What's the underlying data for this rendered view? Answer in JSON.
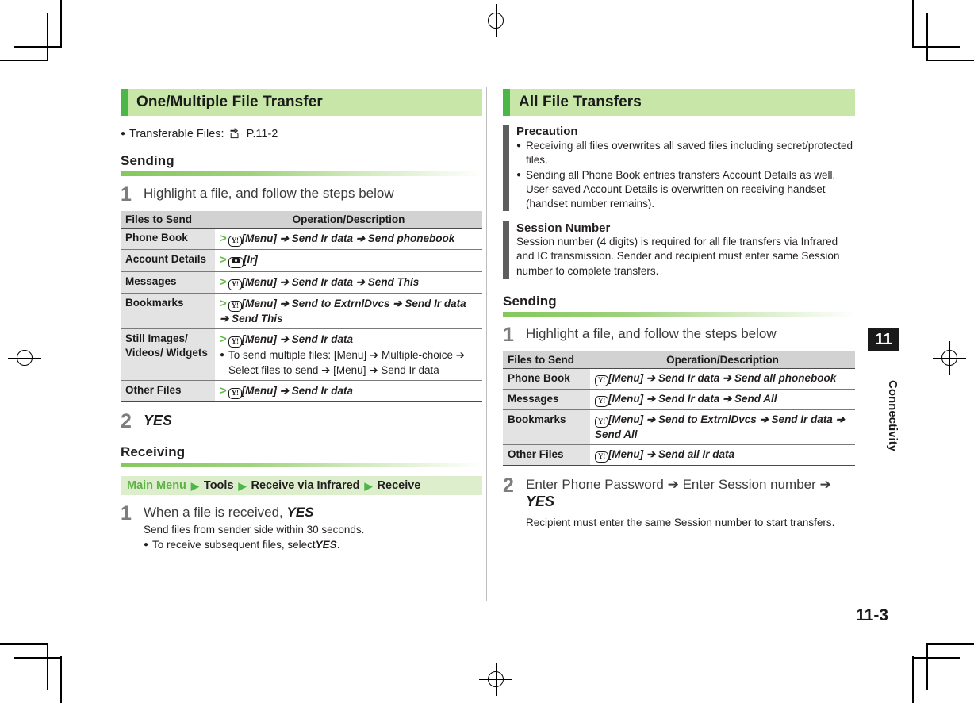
{
  "page": {
    "number": "11-3",
    "chapter_number": "11",
    "chapter_label": "Connectivity"
  },
  "left_column": {
    "section_title": "One/Multiple File Transfer",
    "intro_bullet": {
      "label": "Transferable Files:",
      "icon": "pointing-hand-icon",
      "reference": "P.11-2"
    },
    "sending": {
      "heading": "Sending",
      "step1": {
        "number": "1",
        "text": "Highlight a file, and follow the steps below"
      },
      "table": {
        "headers": [
          "Files to Send",
          "Operation/Description"
        ],
        "rows": [
          {
            "label": "Phone Book",
            "marker": ">",
            "key": "Y!",
            "op": "[Menu] ➔ Send Ir data ➔ Send phonebook"
          },
          {
            "label": "Account Details",
            "marker": ">",
            "key": "camera",
            "op": "[Ir]"
          },
          {
            "label": "Messages",
            "marker": ">",
            "key": "Y!",
            "op": "[Menu] ➔ Send Ir data ➔ Send This"
          },
          {
            "label": "Bookmarks",
            "marker": ">",
            "key": "Y!",
            "op": "[Menu] ➔ Send to ExtrnlDvcs ➔ Send Ir data ➔ Send This"
          },
          {
            "label": "Still Images/ Videos/ Widgets",
            "marker": ">",
            "key": "Y!",
            "op": "[Menu] ➔ Send Ir data",
            "note": "To send multiple files: [Menu] ➔ Multiple-choice ➔ Select files to send ➔ [Menu] ➔ Send Ir data"
          },
          {
            "label": "Other Files",
            "marker": ">",
            "key": "Y!",
            "op": "[Menu] ➔ Send Ir data"
          }
        ]
      },
      "step2": {
        "number": "2",
        "text": "YES"
      }
    },
    "receiving": {
      "heading": "Receiving",
      "nav_path": [
        "Main Menu",
        "Tools",
        "Receive via Infrared",
        "Receive"
      ],
      "step1": {
        "number": "1",
        "text_plain": "When a file is received,",
        "text_bold": "YES",
        "sub1": "Send files from sender side within 30 seconds.",
        "sub2_plain": "To receive subsequent files, select",
        "sub2_bold": "YES",
        "sub2_tail": "."
      }
    }
  },
  "right_column": {
    "section_title": "All File Transfers",
    "precaution": {
      "title": "Precaution",
      "items": [
        "Receiving all files overwrites all saved files including secret/protected files.",
        "Sending all Phone Book entries transfers Account Details as well. User-saved Account Details is overwritten on receiving handset (handset number remains)."
      ]
    },
    "session_number": {
      "title": "Session Number",
      "text": "Session number (4 digits) is required for all file transfers via Infrared and IC transmission. Sender and recipient must enter same Session number to complete transfers."
    },
    "sending": {
      "heading": "Sending",
      "step1": {
        "number": "1",
        "text": "Highlight a file, and follow the steps below"
      },
      "table": {
        "headers": [
          "Files to Send",
          "Operation/Description"
        ],
        "rows": [
          {
            "label": "Phone Book",
            "key": "Y!",
            "op": "[Menu] ➔ Send Ir data ➔ Send all phonebook"
          },
          {
            "label": "Messages",
            "key": "Y!",
            "op": "[Menu] ➔ Send Ir data ➔ Send All"
          },
          {
            "label": "Bookmarks",
            "key": "Y!",
            "op": "[Menu] ➔ Send to ExtrnlDvcs ➔ Send Ir data ➔ Send All"
          },
          {
            "label": "Other Files",
            "key": "Y!",
            "op": "[Menu] ➔ Send all Ir data"
          }
        ]
      },
      "step2": {
        "number": "2",
        "text_line1": "Enter Phone Password ➔ Enter Session number ➔",
        "text_line2": "YES",
        "sub": "Recipient must enter the same Session number to start transfers."
      }
    }
  },
  "colors": {
    "accent_green_dark": "#4cb648",
    "accent_green_band": "#c7e6a8",
    "nav_band": "#ddeecd",
    "table_header": "#d2d2d2",
    "table_label_cell": "#e3e3e3",
    "note_sidebar": "#5e5e5e",
    "step_number": "#7d7d7d"
  }
}
